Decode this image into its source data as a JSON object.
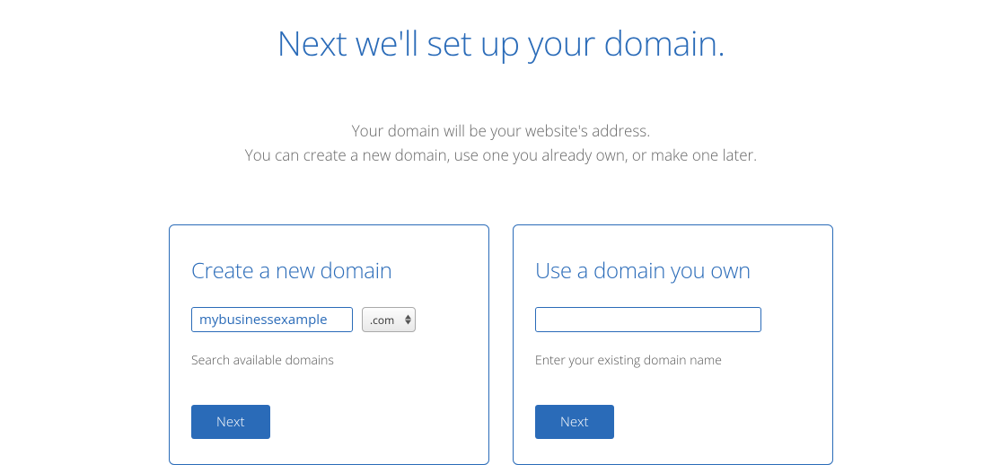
{
  "title": "Next we'll set up your domain.",
  "subtitle_line1": "Your domain will be your website's address.",
  "subtitle_line2": "You can create a new domain, use one you already own, or make one later.",
  "create_card": {
    "title": "Create a new domain",
    "input_value": "mybusinessexample",
    "tld_selected": ".com",
    "help_text": "Search available domains",
    "button_label": "Next"
  },
  "use_card": {
    "title": "Use a domain you own",
    "input_value": "",
    "help_text": "Enter your existing domain name",
    "button_label": "Next"
  }
}
